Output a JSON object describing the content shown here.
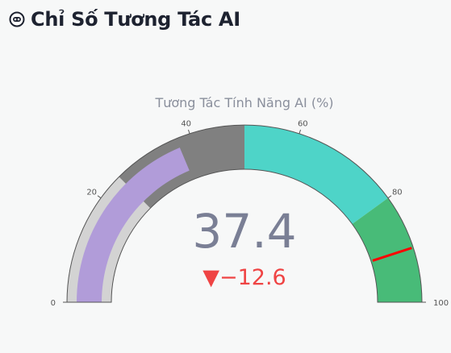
{
  "header": {
    "logo_icon": "robot-face-icon",
    "title": "Chỉ Số Tương Tác AI"
  },
  "gauge": {
    "title": "Tương Tác Tính Năng AI (%)",
    "value": 37.4,
    "value_text": "37.4",
    "delta_text": "▼−12.6",
    "delta_color": "#ef4444",
    "range": [
      0,
      100
    ],
    "ticks": [
      "0",
      "20",
      "40",
      "60",
      "80",
      "100"
    ],
    "steps": [
      {
        "from": 0,
        "to": 25,
        "color": "#d3d3d3"
      },
      {
        "from": 25,
        "to": 50,
        "color": "#808080"
      },
      {
        "from": 50,
        "to": 80,
        "color": "#4ed4c8"
      },
      {
        "from": 80,
        "to": 100,
        "color": "#48bb78"
      }
    ],
    "bar_color": "#b19cd9",
    "threshold": {
      "value": 90,
      "color": "#ff0000"
    },
    "value_color": "#7a7f95"
  }
}
